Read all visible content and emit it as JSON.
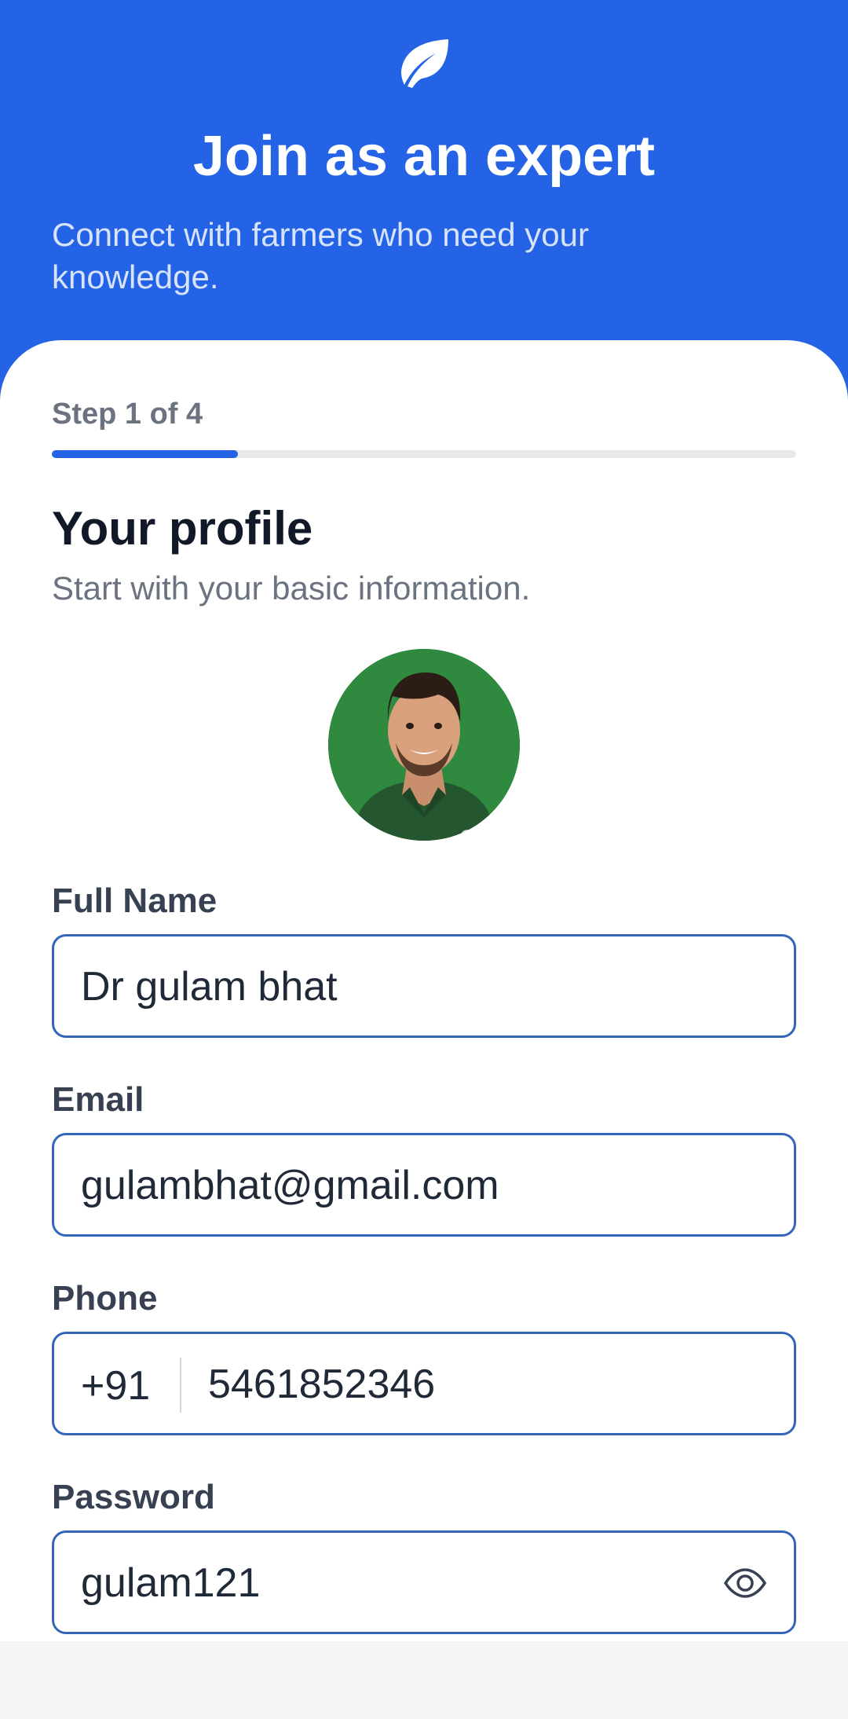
{
  "header": {
    "logo_icon": "leaf-icon",
    "title": "Join as an expert",
    "subtitle": "Connect with farmers who need your knowledge."
  },
  "step": {
    "label": "Step 1 of 4",
    "current": 1,
    "total": 4,
    "progress_fraction": 0.25
  },
  "section": {
    "title": "Your profile",
    "subtitle": "Start with your basic information."
  },
  "form": {
    "full_name": {
      "label": "Full Name",
      "value": "Dr gulam bhat"
    },
    "email": {
      "label": "Email",
      "value": "gulambhat@gmail.com"
    },
    "phone": {
      "label": "Phone",
      "prefix": "+91",
      "value": "5461852346"
    },
    "password": {
      "label": "Password",
      "value": "gulam121",
      "toggle_icon": "eye-icon"
    }
  },
  "colors": {
    "brand": "#2563e6",
    "field_border": "#3565b8",
    "avatar_bg": "#2f8a3f"
  }
}
